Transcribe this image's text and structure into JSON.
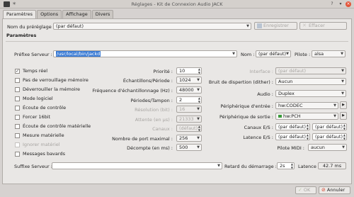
{
  "window": {
    "title": "Réglages - Kit de Connexion Audio JACK"
  },
  "tabs": [
    "Paramètres",
    "Options",
    "Affichage",
    "Divers"
  ],
  "preset": {
    "label": "Nom du préréglage :",
    "value": "(par défaut)",
    "save_label": "Enregistrer",
    "clear_label": "Effacer"
  },
  "section_title": "Paramètres",
  "server": {
    "prefix_label": "Préfixe Serveur :",
    "prefix_value": "/usr/local/bin/jackd",
    "name_label": "Nom :",
    "name_value": "(par défaut)",
    "driver_label": "Pilote :",
    "driver_value": "alsa"
  },
  "checkboxes": [
    {
      "label": "Temps réel",
      "checked": true,
      "disabled": false
    },
    {
      "label": "Pas de verrouillage mémoire",
      "checked": false,
      "disabled": false
    },
    {
      "label": "Déverrouiller la mémoire",
      "checked": false,
      "disabled": false
    },
    {
      "label": "Mode logiciel",
      "checked": false,
      "disabled": false
    },
    {
      "label": "Écoute de contrôle",
      "checked": false,
      "disabled": false
    },
    {
      "label": "Forcer 16bit",
      "checked": false,
      "disabled": false
    },
    {
      "label": "Écoute de contrôle matérielle",
      "checked": false,
      "disabled": false
    },
    {
      "label": "Mesure matérielle",
      "checked": false,
      "disabled": false
    },
    {
      "label": "Ignorer matériel",
      "checked": false,
      "disabled": true
    },
    {
      "label": "Messages bavards",
      "checked": false,
      "disabled": false
    }
  ],
  "middle": [
    {
      "label": "Priorité :",
      "value": "10",
      "disabled": false
    },
    {
      "label": "Échantillons/Période :",
      "value": "1024",
      "disabled": false
    },
    {
      "label": "Fréquence d'échantillonnage (Hz) :",
      "value": "48000",
      "disabled": false
    },
    {
      "label": "Périodes/Tampon :",
      "value": "2",
      "disabled": false
    },
    {
      "label": "Résolution (bit) :",
      "value": "16",
      "disabled": true
    },
    {
      "label": "Attente (en µs) :",
      "value": "21333",
      "disabled": true
    },
    {
      "label": "Canaux :",
      "value": "(défaut)",
      "disabled": true
    },
    {
      "label": "Nombre de port maximal :",
      "value": "256",
      "disabled": false
    },
    {
      "label": "Décompte (en ms) :",
      "value": "500",
      "disabled": false
    }
  ],
  "right": {
    "interface_label": "Interface :",
    "interface_value": "(par défaut)",
    "dither_label": "Bruit de dispertion (dither) :",
    "dither_value": "Aucun",
    "audio_label": "Audio :",
    "audio_value": "Duplex",
    "input_label": "Périphérique d'entrée :",
    "input_value": "hw:CODEC",
    "output_label": "Périphérique de sortie :",
    "output_value": "hw:PCH",
    "channels_label": "Canaux E/S :",
    "channels_in": "(par défaut)",
    "channels_out": "(par défaut)",
    "latency_label": "Latence E/S :",
    "latency_in": "(par défaut)",
    "latency_out": "(par défaut)",
    "midi_label": "Pilote MIDI :",
    "midi_value": "aucun"
  },
  "suffix": {
    "label": "Suffixe Serveur :",
    "value": "",
    "delay_label": "Retard du démarrage :",
    "delay_value": "2s",
    "latency_label": "Latence :",
    "latency_value": "42.7 ms"
  },
  "footer": {
    "ok_label": "OK",
    "cancel_label": "Annuler"
  }
}
